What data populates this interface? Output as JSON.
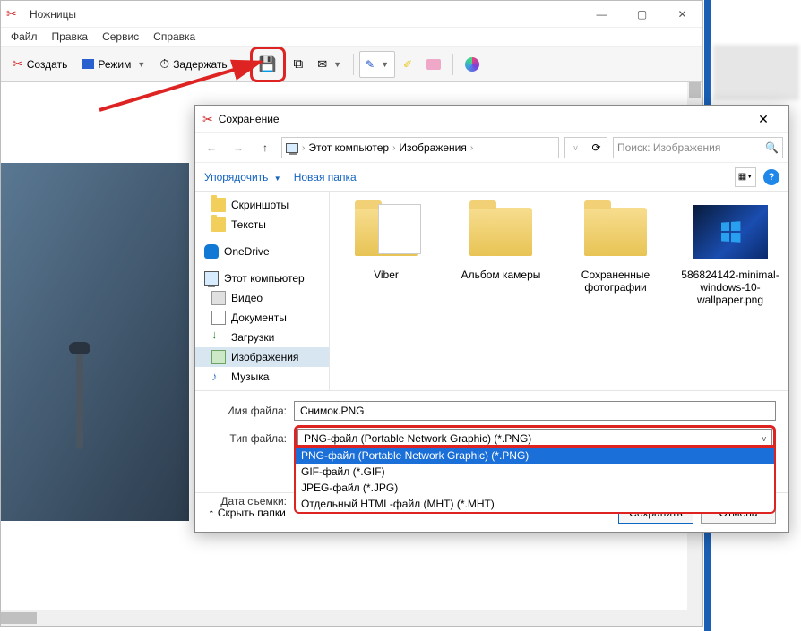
{
  "app": {
    "title": "Ножницы",
    "menu": [
      "Файл",
      "Правка",
      "Сервис",
      "Справка"
    ],
    "toolbar": {
      "new": "Создать",
      "mode": "Режим",
      "delay": "Задержать"
    }
  },
  "dialog": {
    "title": "Сохранение",
    "breadcrumb": {
      "root": "Этот компьютер",
      "folder": "Изображения"
    },
    "search_placeholder": "Поиск: Изображения",
    "organize": "Упорядочить",
    "newfolder": "Новая папка",
    "tree": {
      "screenshots": "Скриншоты",
      "texts": "Тексты",
      "onedrive": "OneDrive",
      "thispc": "Этот компьютер",
      "videos": "Видео",
      "documents": "Документы",
      "downloads": "Загрузки",
      "pictures": "Изображения",
      "music": "Музыка"
    },
    "files": {
      "viber": "Viber",
      "camera": "Альбом камеры",
      "saved": "Сохраненные фотографии",
      "wall": "586824142-minimal-windows-10-wallpaper.png"
    },
    "labels": {
      "filename": "Имя файла:",
      "filetype": "Тип файла:",
      "date": "Дата съемки:"
    },
    "filename_value": "Снимок.PNG",
    "filetype_value": "PNG-файл (Portable Network Graphic) (*.PNG)",
    "options": {
      "png": "PNG-файл (Portable Network Graphic) (*.PNG)",
      "gif": "GIF-файл (*.GIF)",
      "jpg": "JPEG-файл (*.JPG)",
      "mht": "Отдельный HTML-файл (MHT) (*.MHT)"
    },
    "hide": "Скрыть папки",
    "save": "Сохранить",
    "cancel": "Отмена"
  }
}
